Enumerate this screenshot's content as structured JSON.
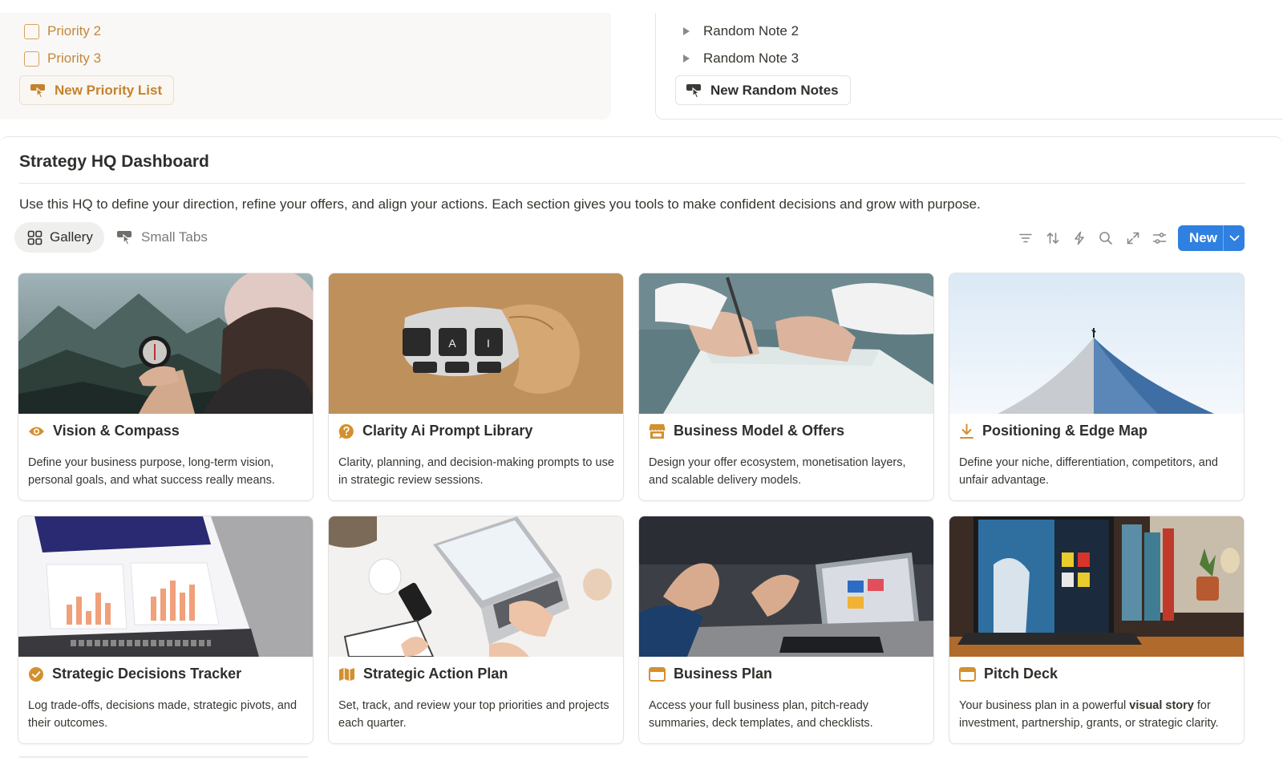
{
  "priority_panel": {
    "items": [
      {
        "label": "Priority 2"
      },
      {
        "label": "Priority 3"
      }
    ],
    "new_button": "New Priority List"
  },
  "notes_panel": {
    "items": [
      {
        "label": "Random Note 2"
      },
      {
        "label": "Random Note 3"
      }
    ],
    "new_button": "New Random Notes"
  },
  "dashboard": {
    "title": "Strategy HQ Dashboard",
    "description": "Use this HQ to define your direction, refine your offers, and align your actions. Each section gives you tools to make confident decisions and grow with purpose.",
    "views": [
      {
        "label": "Gallery",
        "active": true
      },
      {
        "label": "Small Tabs",
        "active": false
      }
    ],
    "toolbar": {
      "icons": [
        "filter-icon",
        "sort-icon",
        "automation-icon",
        "search-icon",
        "expand-icon",
        "settings-icon"
      ],
      "new_label": "New"
    },
    "cards": [
      {
        "title": "Vision & Compass",
        "icon": "eye-icon",
        "description": "Define your business purpose, long-term vision, personal goals, and what success really means."
      },
      {
        "title": "Clarity Ai Prompt Library",
        "icon": "chat-question-icon",
        "description": "Clarity, planning, and decision-making prompts to use in strategic review sessions."
      },
      {
        "title": "Business Model & Offers",
        "icon": "storefront-icon",
        "description": "Design your offer ecosystem, monetisation layers, and scalable delivery models."
      },
      {
        "title": "Positioning & Edge Map",
        "icon": "download-icon",
        "description": "Define your niche, differentiation, competitors, and unfair advantage."
      },
      {
        "title": "Strategic Decisions Tracker",
        "icon": "check-circle-icon",
        "description": "Log trade-offs, decisions made, strategic pivots, and their outcomes."
      },
      {
        "title": "Strategic Action Plan",
        "icon": "map-icon",
        "description": "Set, track, and review your top priorities and projects each quarter."
      },
      {
        "title": "Business Plan",
        "icon": "browser-window-icon",
        "description": "Access your full business plan, pitch-ready summaries, deck templates, and checklists."
      },
      {
        "title": "Pitch Deck",
        "icon": "browser-window-icon",
        "description_pre": "Your business plan in a powerful ",
        "description_bold": "visual story",
        "description_post": " for investment, partnership, grants, or strategic clarity."
      }
    ],
    "cover_labels": {
      "ai_key_a": "A",
      "ai_key_i": "I"
    }
  },
  "colors": {
    "accent_gold": "#d3902f",
    "priority_text": "#c4883a",
    "new_button_blue": "#2f80e0",
    "panel_bg": "#f9f8f6"
  }
}
